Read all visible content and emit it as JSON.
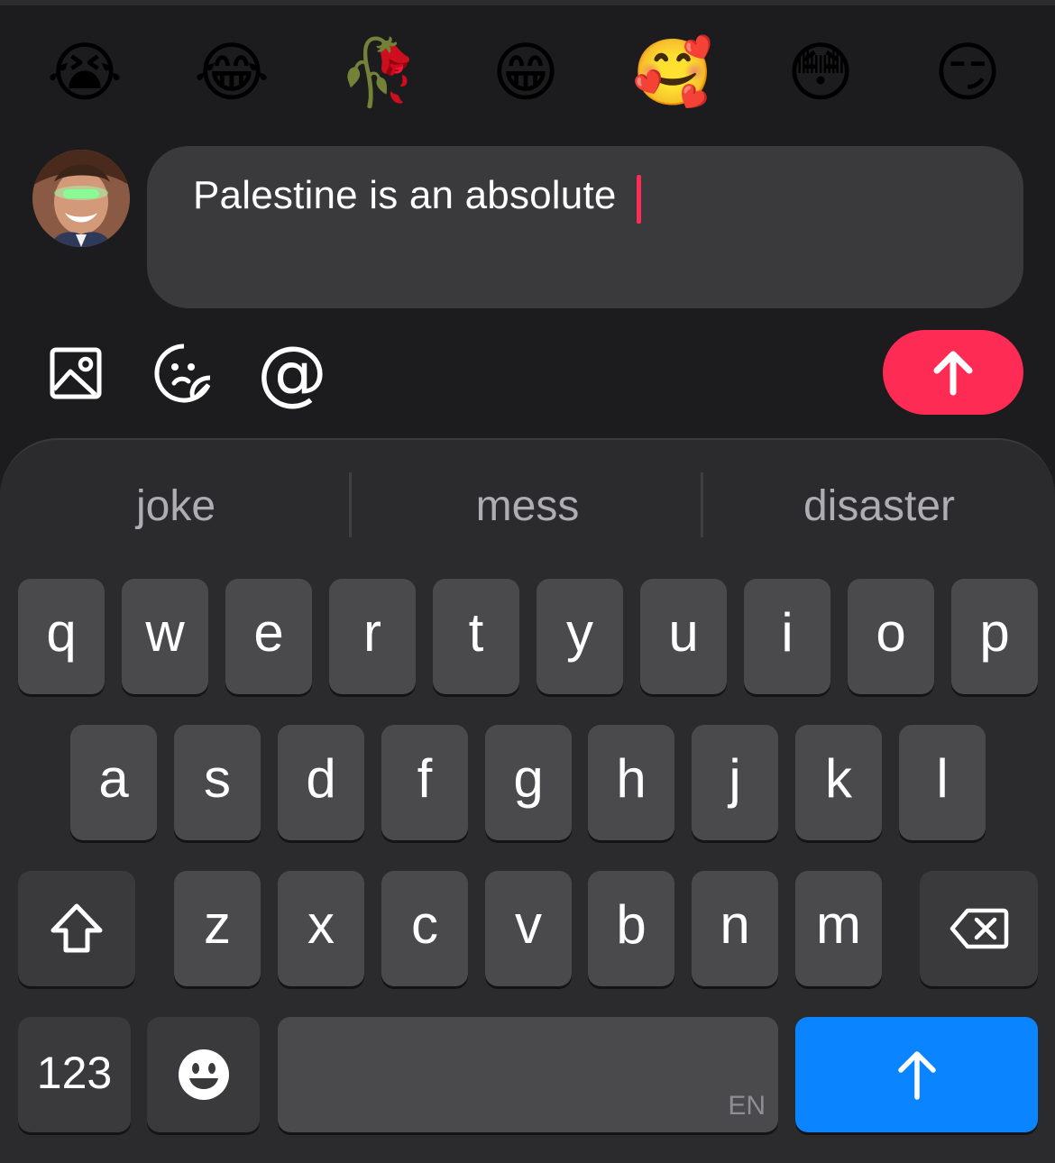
{
  "emoji_reactions": [
    "😭",
    "😂",
    "🥀",
    "😁",
    "🥰",
    "😳",
    "😏"
  ],
  "composer": {
    "text": "Palestine is an absolute",
    "avatar_alt": "",
    "send_color": "#fe2c55"
  },
  "toolbar": {
    "icons": [
      "image-icon",
      "sticker-icon",
      "mention-icon"
    ],
    "mention_glyph": "@"
  },
  "suggestions": [
    "joke",
    "mess",
    "disaster"
  ],
  "keyboard": {
    "row1": [
      "q",
      "w",
      "e",
      "r",
      "t",
      "y",
      "u",
      "i",
      "o",
      "p"
    ],
    "row2": [
      "a",
      "s",
      "d",
      "f",
      "g",
      "h",
      "j",
      "k",
      "l"
    ],
    "row3": [
      "z",
      "x",
      "c",
      "v",
      "b",
      "n",
      "m"
    ],
    "numbers_label": "123",
    "language_label": "EN",
    "return_color": "#0a84ff"
  }
}
